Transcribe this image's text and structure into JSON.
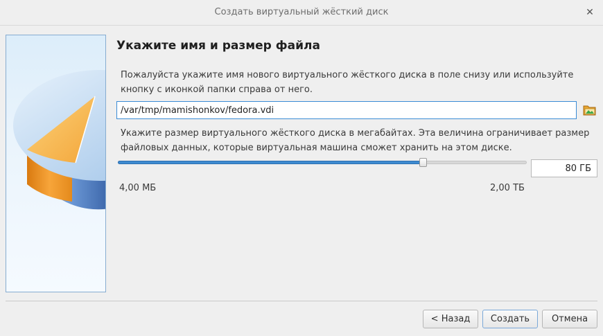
{
  "window": {
    "title": "Создать виртуальный жёсткий диск",
    "close_glyph": "✕"
  },
  "page": {
    "title": "Укажите имя и размер файла",
    "location_description": "Пожалуйста укажите имя нового виртуального жёсткого диска в поле снизу или используйте кнопку с иконкой папки справа от него.",
    "file_path": "/var/tmp/mamishonkov/fedora.vdi",
    "size_description": "Укажите размер виртуального жёсткого диска в мегабайтах. Эта величина ограничивает размер файловых данных, которые виртуальная машина сможет хранить на этом диске.",
    "size_value": "80 ГБ",
    "size_slider_fraction": 0.745,
    "scale_min": "4,00 МБ",
    "scale_max": "2,00 ТБ"
  },
  "buttons": {
    "back": "< Назад",
    "create": "Создать",
    "cancel": "Отмена"
  },
  "icons": {
    "close": "close-icon",
    "folder": "folder-open-icon",
    "disk_art": "hard-disk-illustration"
  },
  "colors": {
    "accent": "#3a8bd6",
    "slider_fill": "#3d8ad0"
  }
}
